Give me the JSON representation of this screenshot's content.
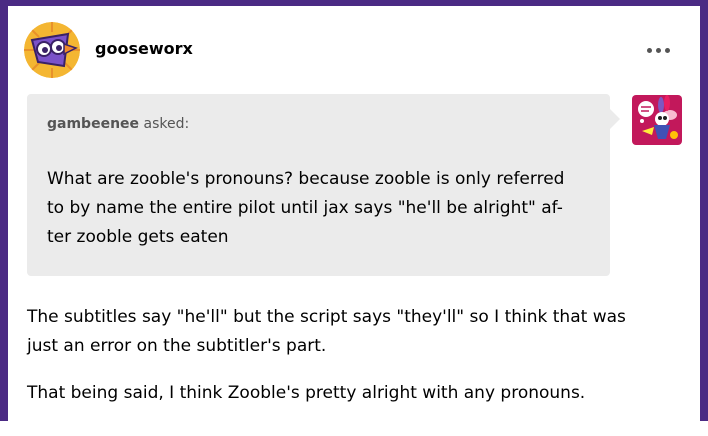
{
  "post": {
    "blog_name": "gooseworx",
    "more_options_icon": "ellipsis-horizontal-icon",
    "avatar_icon": "purple-goose-avatar",
    "ask": {
      "asker_name": "gambeenee",
      "asked_label": "asked:",
      "asker_avatar_icon": "pink-character-avatar",
      "question_lines": [
        "What are zooble's pronouns? because zooble is only referred",
        "to by name the entire pilot until jax says \"he'll be alright\" af-",
        "ter zooble gets eaten"
      ]
    },
    "answer": {
      "paragraph1_lines": [
        "The subtitles say \"he'll\" but the script says \"they'll\" so I think that was",
        "just an error on the subtitler's part."
      ],
      "paragraph2_lines": [
        "That being said, I think Zooble's pretty alright with any pronouns."
      ]
    }
  },
  "colors": {
    "page_background": "#4b2a84",
    "card_background": "#ffffff",
    "ask_background": "#ebebeb",
    "asker_text": "#555555"
  }
}
